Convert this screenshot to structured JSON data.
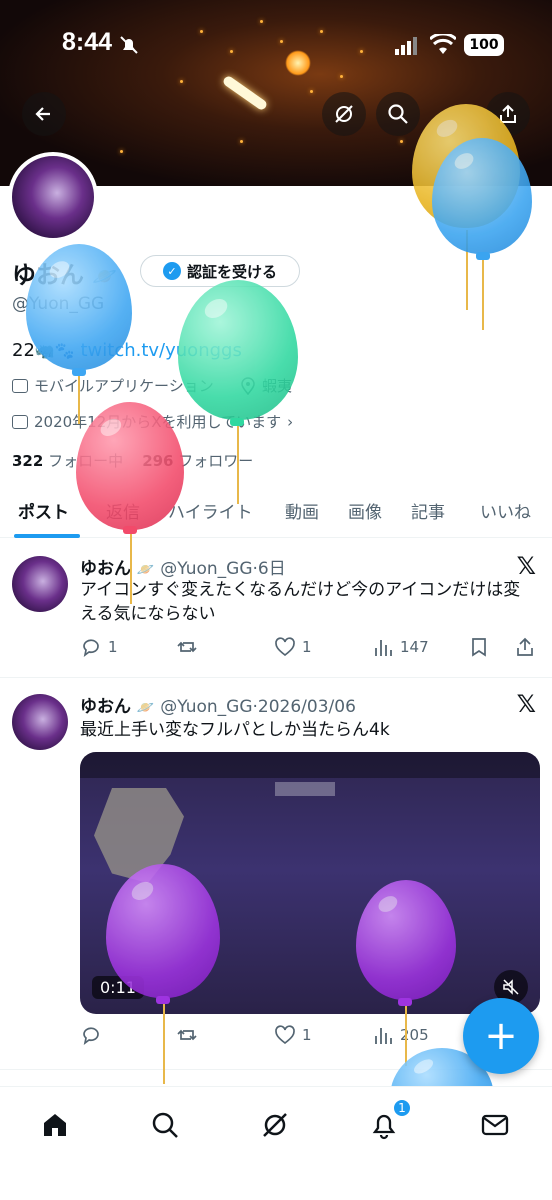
{
  "status_bar": {
    "time": "8:44",
    "battery": "100"
  },
  "profile": {
    "display_name": "ゆおん",
    "verify_label": "認証を受ける",
    "handle": "@Yuon_GG",
    "bio_prefix": "22",
    "bio_link": "twitch.tv/yuonggs",
    "category": "モバイルアプリケーション",
    "location": "蝦夷",
    "joined": "2020年12月からXを利用しています",
    "following_count": "322",
    "following_label": "フォロー中",
    "followers_count": "296",
    "followers_label": "フォロワー"
  },
  "tabs": [
    "ポスト",
    "返信",
    "ハイライト",
    "動画",
    "画像",
    "記事",
    "いいね"
  ],
  "posts": [
    {
      "name": "ゆおん",
      "handle": "@Yuon_GG",
      "time": "6日",
      "text": "アイコンすぐ変えたくなるんだけど今のアイコンだけは変える気にならない",
      "replies": "1",
      "likes": "1",
      "views": "147"
    },
    {
      "name": "ゆおん",
      "handle": "@Yuon_GG",
      "time": "2026/03/06",
      "text": "最近上手い変なフルパとしか当たらん4k",
      "video_time": "0:11",
      "replies": "",
      "likes": "1",
      "views": "205"
    }
  ],
  "notifications_badge": "1",
  "icons": {
    "back": "back-arrow-icon",
    "grok": "grok-icon",
    "search": "search-icon",
    "share": "share-icon",
    "home": "home-icon",
    "mail": "mail-icon",
    "bell": "bell-icon"
  },
  "colors": {
    "accent": "#1d9bf0",
    "text": "#0f1419",
    "muted": "#536471"
  }
}
